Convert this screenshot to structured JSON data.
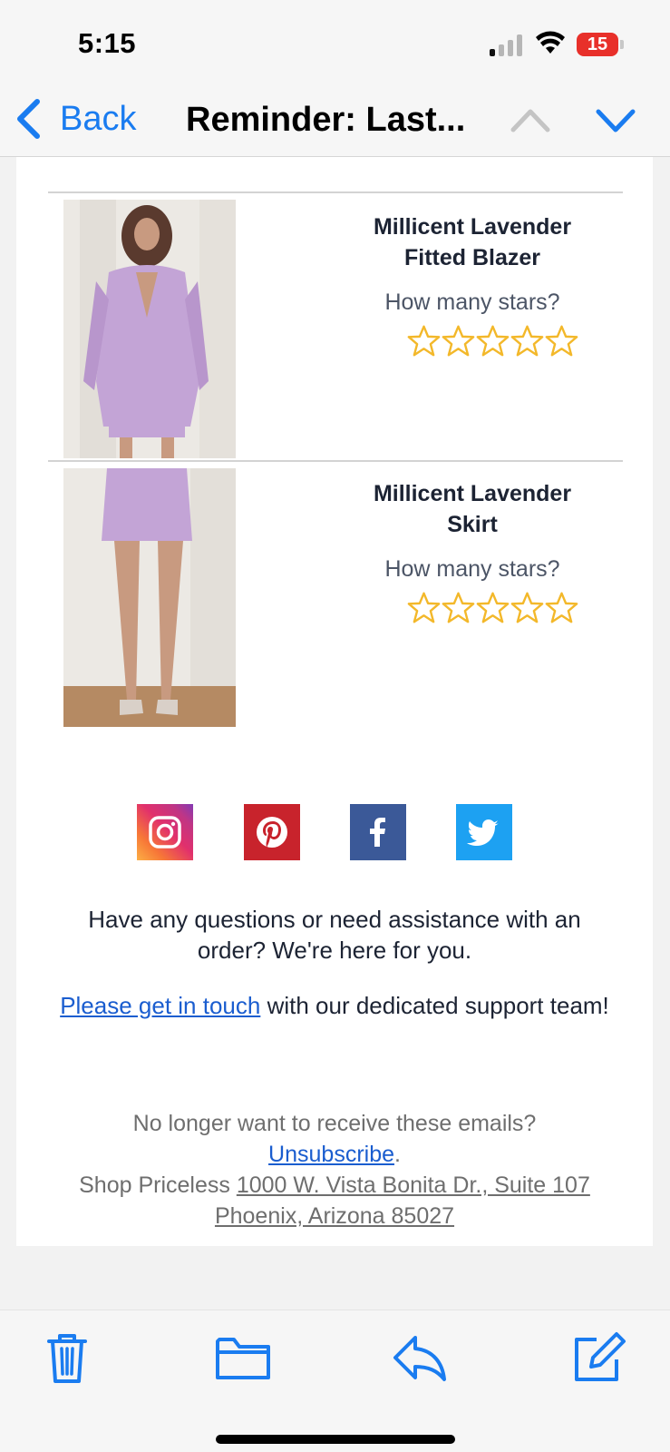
{
  "status_bar": {
    "time": "5:15",
    "battery": "15"
  },
  "nav": {
    "back_label": "Back",
    "title": "Reminder: Last..."
  },
  "products": [
    {
      "name_line1": "Millicent Lavender",
      "name_line2": "Fitted Blazer",
      "stars_question": "How many stars?",
      "rating": 0,
      "max_rating": 5
    },
    {
      "name_line1": "Millicent Lavender",
      "name_line2": "Skirt",
      "stars_question": "How many stars?",
      "rating": 0,
      "max_rating": 5
    }
  ],
  "socials": [
    "instagram",
    "pinterest",
    "facebook",
    "twitter"
  ],
  "help": {
    "line1": "Have any questions or need assistance with an",
    "line2": "order? We're here for you.",
    "contact_link": "Please get in touch",
    "contact_rest": " with our dedicated support team!"
  },
  "footer": {
    "question": "No longer want to receive these emails?",
    "unsubscribe": "Unsubscribe",
    "period": ".",
    "company": "Shop Priceless",
    "address_line1": "1000 W. Vista Bonita Dr., Suite 107",
    "address_line2": "Phoenix, Arizona 85027"
  },
  "colors": {
    "accent": "#1a7cf0",
    "star": "#f3b82a",
    "instagram": "#e1306c",
    "pinterest": "#c8232c",
    "facebook": "#3b5998",
    "twitter": "#1da1f2"
  }
}
